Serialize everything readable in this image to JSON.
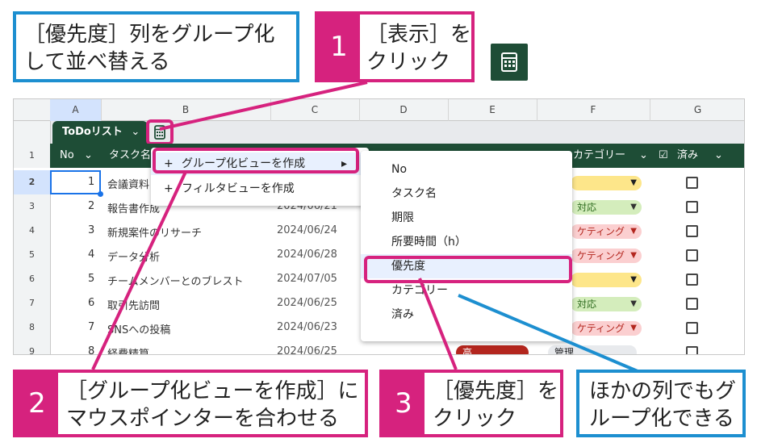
{
  "callouts": {
    "intro": "［優先度］列をグループ化\nして並べ替える",
    "step1_num": "1",
    "step1_text": "［表示］を\nクリック",
    "step2_num": "2",
    "step2_text": "［グループ化ビューを作成］に\nマウスポインターを合わせる",
    "step3_num": "3",
    "step3_text": "［優先度］を\nクリック",
    "note": "ほかの列でもグ\nループ化できる"
  },
  "sheet": {
    "columns": [
      "A",
      "B",
      "C",
      "D",
      "E",
      "F",
      "G"
    ],
    "table_name": "ToDoリスト",
    "headers": {
      "no": "No",
      "task": "タスク名",
      "category": "カテゴリー",
      "done": "済み"
    },
    "rows": [
      {
        "rn": "1"
      },
      {
        "rn": "2",
        "no": "1",
        "task": "会議資料"
      },
      {
        "rn": "3",
        "no": "2",
        "task": "報告書作成",
        "date": "2024/06/21",
        "cat": "対応"
      },
      {
        "rn": "4",
        "no": "3",
        "task": "新規案件のリサーチ",
        "date": "2024/06/24",
        "cat": "ケティング"
      },
      {
        "rn": "5",
        "no": "4",
        "task": "データ分析",
        "date": "2024/06/28",
        "cat": "ケティング"
      },
      {
        "rn": "6",
        "no": "5",
        "task": "チームメンバーとのブレスト",
        "date": "2024/07/05"
      },
      {
        "rn": "7",
        "no": "6",
        "task": "取引先訪問",
        "date": "2024/06/25",
        "cat": "対応"
      },
      {
        "rn": "8",
        "no": "7",
        "task": "SNSへの投稿",
        "date": "2024/06/23",
        "cat": "ケティング"
      },
      {
        "rn": "9",
        "no": "8",
        "task": "経費精算",
        "date": "2024/06/25",
        "prio": "高",
        "cat": "管理"
      }
    ]
  },
  "view_menu": {
    "create_group_view": "グループ化ビューを作成",
    "create_filter_view": "フィルタビューを作成",
    "plus": "+",
    "arrow": "▸"
  },
  "submenu": [
    "No",
    "タスク名",
    "期限",
    "所要時間（h）",
    "優先度",
    "カテゴリー",
    "済み"
  ],
  "colors": {
    "pink": "#d6227e",
    "blue": "#1d8fd0",
    "green_header": "#1e4d36"
  }
}
